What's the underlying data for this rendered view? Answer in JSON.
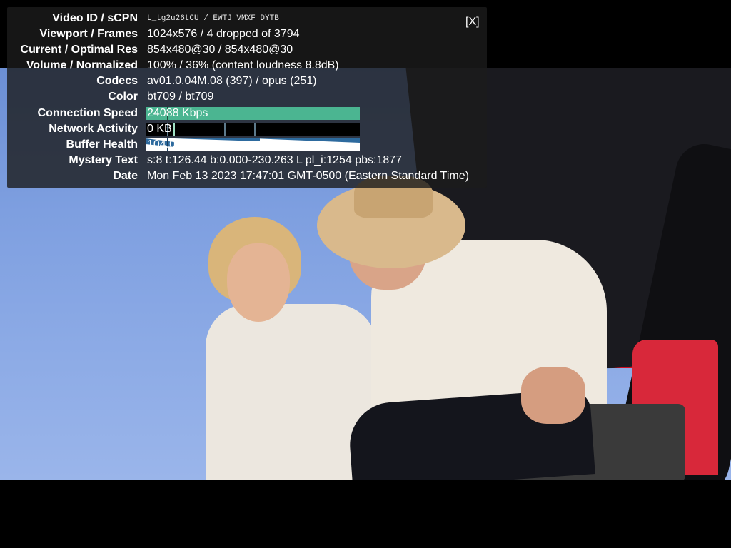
{
  "overlay": {
    "close_label": "[X]",
    "rows": [
      {
        "label": "Video ID / sCPN",
        "value": "L_tg2u26tCU / EWTJ VMXF DYTB"
      },
      {
        "label": "Viewport / Frames",
        "value": "1024x576 / 4 dropped of 3794"
      },
      {
        "label": "Current / Optimal Res",
        "value": "854x480@30 / 854x480@30"
      },
      {
        "label": "Volume / Normalized",
        "value": "100% / 36% (content loudness 8.8dB)"
      },
      {
        "label": "Codecs",
        "value": "av01.0.04M.08 (397) / opus (251)"
      },
      {
        "label": "Color",
        "value": "bt709 / bt709"
      },
      {
        "label": "Connection Speed",
        "value": "24088 Kbps"
      },
      {
        "label": "Network Activity",
        "value": "0 KB"
      },
      {
        "label": "Buffer Health",
        "value": "104.01 s"
      },
      {
        "label": "Mystery Text",
        "value": "s:8 t:126.44 b:0.000-230.263 L pl_i:1254 pbs:1877"
      },
      {
        "label": "Date",
        "value": "Mon Feb 13 2023 17:47:01 GMT-0500 (Eastern Standard Time)"
      }
    ]
  },
  "colors": {
    "graph_fill": "#4fbf99",
    "buffer_fill": "#2d6a9e",
    "panel_bg": "rgba(28,28,28,0.8)"
  }
}
